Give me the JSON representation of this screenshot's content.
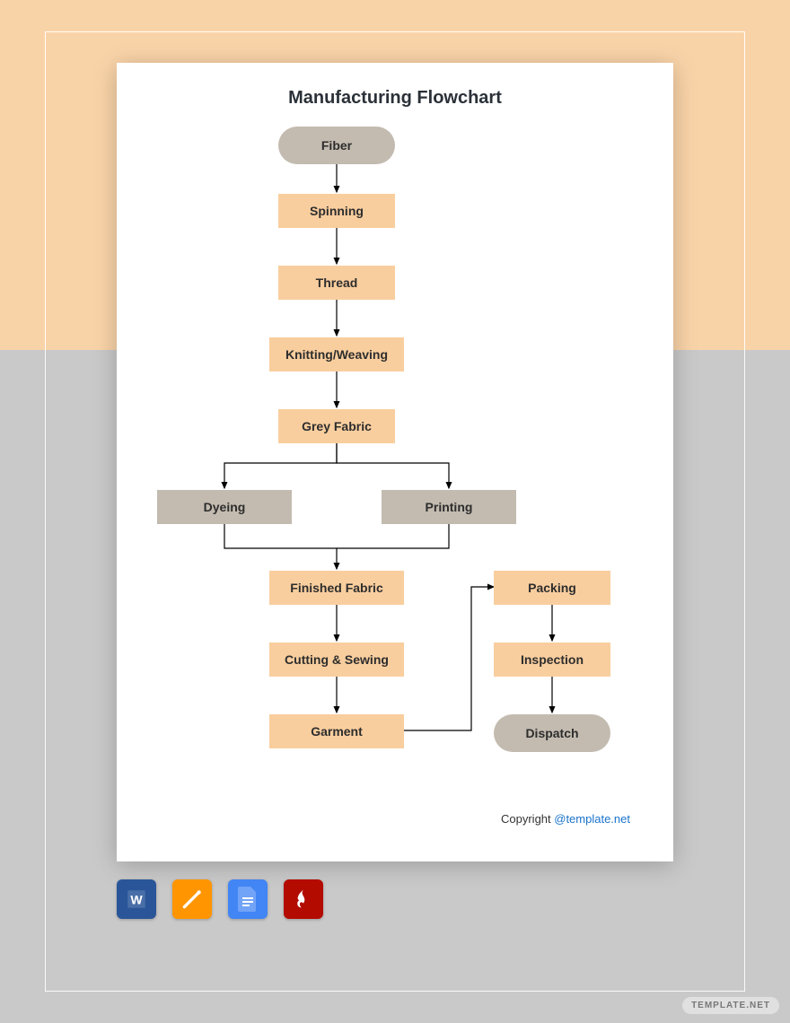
{
  "title": "Manufacturing Flowchart",
  "nodes": {
    "fiber": "Fiber",
    "spinning": "Spinning",
    "thread": "Thread",
    "knitting": "Knitting/Weaving",
    "grey_fabric": "Grey Fabric",
    "dyeing": "Dyeing",
    "printing": "Printing",
    "finished_fabric": "Finished Fabric",
    "cutting_sewing": "Cutting & Sewing",
    "garment": "Garment",
    "packing": "Packing",
    "inspection": "Inspection",
    "dispatch": "Dispatch"
  },
  "flow_edges": [
    [
      "fiber",
      "spinning"
    ],
    [
      "spinning",
      "thread"
    ],
    [
      "thread",
      "knitting"
    ],
    [
      "knitting",
      "grey_fabric"
    ],
    [
      "grey_fabric",
      "dyeing"
    ],
    [
      "grey_fabric",
      "printing"
    ],
    [
      "dyeing",
      "finished_fabric"
    ],
    [
      "printing",
      "finished_fabric"
    ],
    [
      "finished_fabric",
      "cutting_sewing"
    ],
    [
      "cutting_sewing",
      "garment"
    ],
    [
      "garment",
      "packing"
    ],
    [
      "packing",
      "inspection"
    ],
    [
      "inspection",
      "dispatch"
    ]
  ],
  "copyright": {
    "prefix": "Copyright ",
    "link": "@template.net"
  },
  "icons": {
    "word": "word-icon",
    "pages": "pages-icon",
    "gdoc": "google-docs-icon",
    "pdf": "pdf-icon"
  },
  "watermark": "TEMPLATE.NET",
  "colors": {
    "peach": "#f9ce9e",
    "taupe": "#c3bbb0",
    "bg_top": "#f9d3a8",
    "bg_bottom": "#c9c9c9"
  }
}
